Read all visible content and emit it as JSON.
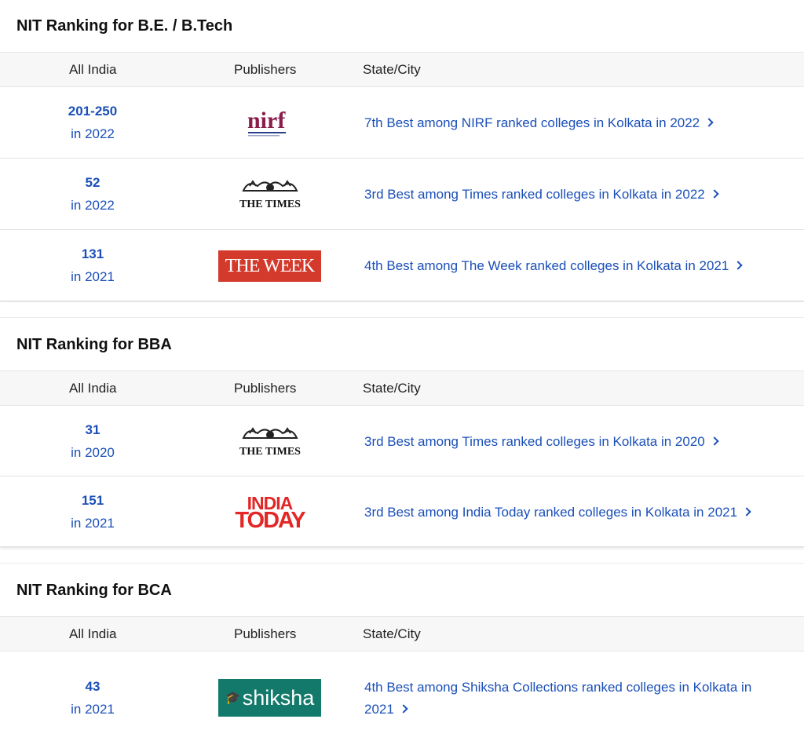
{
  "sections": [
    {
      "title": "NIT Ranking for B.E. / B.Tech",
      "headers": [
        "All India",
        "Publishers",
        "State/City"
      ],
      "rows": [
        {
          "rank": "201-250",
          "year": "in 2022",
          "publisher_icon": "nirf-logo",
          "link": "7th Best among NIRF ranked colleges in Kolkata in 2022"
        },
        {
          "rank": "52",
          "year": "in 2022",
          "publisher_icon": "the-times-logo",
          "link": "3rd Best among Times ranked colleges in Kolkata in 2022"
        },
        {
          "rank": "131",
          "year": "in 2021",
          "publisher_icon": "the-week-logo",
          "link": "4th Best among The Week ranked colleges in Kolkata in 2021"
        }
      ]
    },
    {
      "title": "NIT Ranking for BBA",
      "headers": [
        "All India",
        "Publishers",
        "State/City"
      ],
      "rows": [
        {
          "rank": "31",
          "year": "in 2020",
          "publisher_icon": "the-times-logo",
          "link": "3rd Best among Times ranked colleges in Kolkata in 2020"
        },
        {
          "rank": "151",
          "year": "in 2021",
          "publisher_icon": "india-today-logo",
          "link": "3rd Best among India Today ranked colleges in Kolkata in 2021"
        }
      ]
    },
    {
      "title": "NIT Ranking for BCA",
      "headers": [
        "All India",
        "Publishers",
        "State/City"
      ],
      "rows": [
        {
          "rank": "43",
          "year": "in 2021",
          "publisher_icon": "shiksha-logo",
          "link_line1": "4th Best among Shiksha Collections ranked colleges in Kolkata in",
          "link_line2": "2021"
        }
      ]
    }
  ],
  "logos": {
    "nirf": "nirf",
    "times": "THE TIMES",
    "week": "THE WEEK",
    "india_today_1": "INDIA",
    "india_today_2": "TODAY",
    "shiksha": "shiksha"
  },
  "colors": {
    "link": "#1a4fb8",
    "header_bg": "#f7f7f7",
    "week_red": "#d33a2c",
    "today_red": "#e32626",
    "shiksha_green": "#137a6b"
  }
}
